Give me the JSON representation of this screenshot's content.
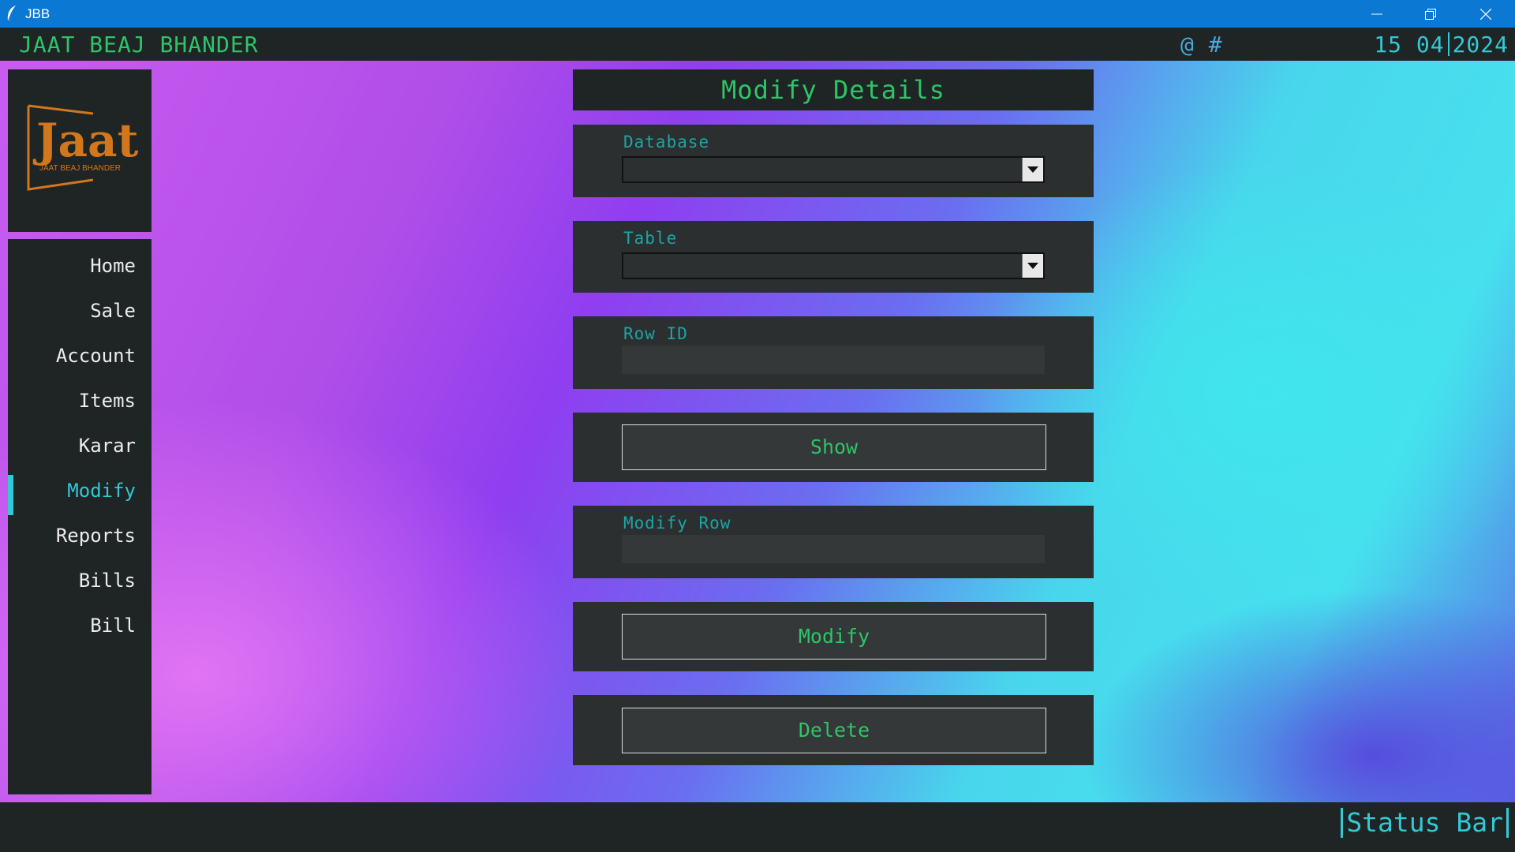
{
  "window": {
    "title": "JBB"
  },
  "header": {
    "brand": "JAAT BEAJ BHANDER",
    "symbols": "@ #",
    "date_day_month": "15 04",
    "date_year": "2024"
  },
  "logo": {
    "wordmark": "Jaat",
    "subtitle": "JAAT BEAJ BHANDER",
    "color": "#d2771c"
  },
  "sidebar": {
    "items": [
      {
        "label": "Home"
      },
      {
        "label": "Sale"
      },
      {
        "label": "Account"
      },
      {
        "label": "Items"
      },
      {
        "label": "Karar"
      },
      {
        "label": "Modify",
        "active": true
      },
      {
        "label": "Reports"
      },
      {
        "label": "Bills"
      },
      {
        "label": "Bill"
      }
    ]
  },
  "main": {
    "title": "Modify Details",
    "database": {
      "label": "Database",
      "value": ""
    },
    "table": {
      "label": "Table",
      "value": ""
    },
    "row_id": {
      "label": "Row ID",
      "value": ""
    },
    "show_button": "Show",
    "modify_row": {
      "label": "Modify Row",
      "value": ""
    },
    "modify_button": "Modify",
    "delete_button": "Delete"
  },
  "status_bar": {
    "text": "Status Bar"
  },
  "colors": {
    "accent_green": "#2fc46a",
    "accent_cyan": "#33c9d6",
    "panel_dark": "#1f2424",
    "titlebar_blue": "#0b78d4"
  }
}
